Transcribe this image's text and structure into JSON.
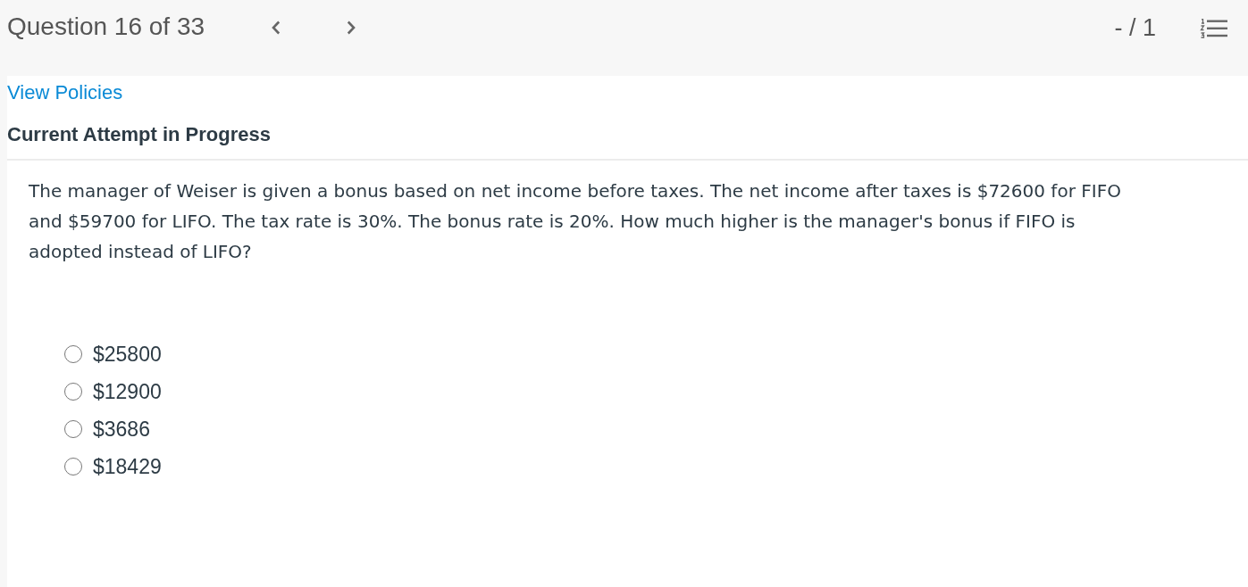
{
  "header": {
    "title": "Question 16 of 33",
    "score": "- / 1"
  },
  "view_policies": "View Policies",
  "attempt_status": "Current Attempt in Progress",
  "question": {
    "text": "The manager of Weiser is given a bonus based on net income before taxes. The net income after taxes is $72600 for FIFO and $59700 for LIFO. The tax rate is 30%. The bonus rate is 20%. How much higher is the manager's bonus if FIFO is adopted instead of LIFO?",
    "options": [
      {
        "label": "$25800",
        "selected": false
      },
      {
        "label": "$12900",
        "selected": false
      },
      {
        "label": "$3686",
        "selected": false
      },
      {
        "label": "$18429",
        "selected": false
      }
    ]
  }
}
